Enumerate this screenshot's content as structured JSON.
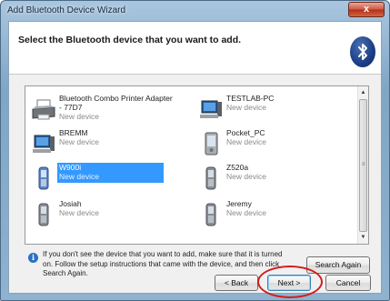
{
  "window": {
    "title": "Add Bluetooth Device Wizard",
    "close_label": "x"
  },
  "header": {
    "title": "Select the Bluetooth device that you want to add.",
    "logo_icon": "bluetooth-icon"
  },
  "devices": [
    {
      "name": "Bluetooth Combo Printer Adapter",
      "name2": "- 77D7",
      "status": "New device",
      "icon": "printer-icon",
      "selected": false
    },
    {
      "name": "TESTLAB-PC",
      "status": "New device",
      "icon": "computer-icon",
      "selected": false
    },
    {
      "name": "BREMM",
      "status": "New device",
      "icon": "computer-icon",
      "selected": false
    },
    {
      "name": "Pocket_PC",
      "status": "New device",
      "icon": "pda-icon",
      "selected": false
    },
    {
      "name": "W900i",
      "status": "New device",
      "icon": "phone-icon",
      "selected": true
    },
    {
      "name": "Z520a",
      "status": "New device",
      "icon": "phone-icon",
      "selected": false
    },
    {
      "name": "Josiah",
      "status": "New device",
      "icon": "phone-icon",
      "selected": false
    },
    {
      "name": "Jeremy",
      "status": "New device",
      "icon": "phone-icon",
      "selected": false
    }
  ],
  "info": {
    "text": "If you don't see the device that you want to add, make sure that it is turned on. Follow the setup instructions that came with the device, and then click Search Again."
  },
  "buttons": {
    "search_again": "Search Again",
    "back": "< Back",
    "next": "Next >",
    "cancel": "Cancel"
  },
  "accent_colors": {
    "selection": "#3399ff",
    "annotation_circle": "#d21c1c"
  }
}
